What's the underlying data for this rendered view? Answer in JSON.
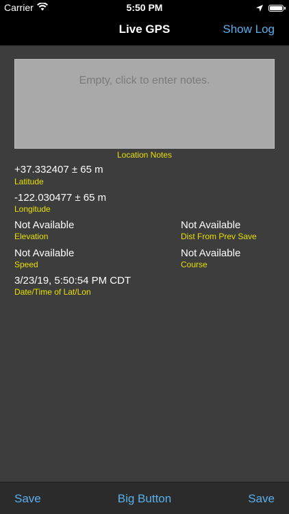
{
  "status_bar": {
    "carrier": "Carrier",
    "time": "5:50 PM"
  },
  "nav": {
    "title": "Live GPS",
    "show_log": "Show Log"
  },
  "notes": {
    "placeholder": "Empty, click to enter notes.",
    "label": "Location Notes"
  },
  "fields": {
    "latitude": {
      "value": "+37.332407 ± 65 m",
      "label": "Latitude"
    },
    "longitude": {
      "value": "-122.030477 ± 65 m",
      "label": "Longitude"
    },
    "elevation": {
      "value": "Not Available",
      "label": "Elevation"
    },
    "dist_from_prev_save": {
      "value": "Not Available",
      "label": "Dist From Prev Save"
    },
    "speed": {
      "value": "Not Available",
      "label": "Speed"
    },
    "course": {
      "value": "Not Available",
      "label": "Course"
    },
    "datetime": {
      "value": "3/23/19, 5:50:54 PM CDT",
      "label": "Date/Time of Lat/Lon"
    }
  },
  "toolbar": {
    "save_left": "Save",
    "big_button": "Big Button",
    "save_right": "Save"
  },
  "colors": {
    "background": "#3d3d3d",
    "accent": "#5ab0ee",
    "label": "#e7e000"
  }
}
